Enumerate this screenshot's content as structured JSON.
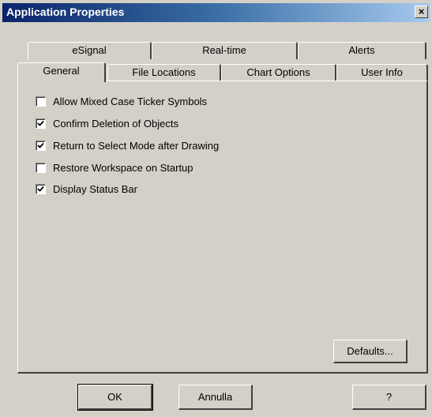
{
  "window": {
    "title": "Application Properties",
    "close_icon": "close-icon",
    "close_glyph": "×"
  },
  "tabs_back": [
    {
      "label": "eSignal"
    },
    {
      "label": "Real-time"
    },
    {
      "label": "Alerts"
    }
  ],
  "tabs_front": [
    {
      "label": "General",
      "active": true
    },
    {
      "label": "File Locations"
    },
    {
      "label": "Chart Options"
    },
    {
      "label": "User Info"
    }
  ],
  "options": [
    {
      "label": "Allow Mixed Case Ticker Symbols",
      "checked": false
    },
    {
      "label": "Confirm Deletion of Objects",
      "checked": true
    },
    {
      "label": "Return to Select Mode after Drawing",
      "checked": true
    },
    {
      "label": "Restore Workspace on Startup",
      "checked": false
    },
    {
      "label": "Display Status Bar",
      "checked": true
    }
  ],
  "panel": {
    "defaults_label": "Defaults..."
  },
  "footer": {
    "ok_label": "OK",
    "cancel_label": "Annulla",
    "help_label": "?"
  }
}
